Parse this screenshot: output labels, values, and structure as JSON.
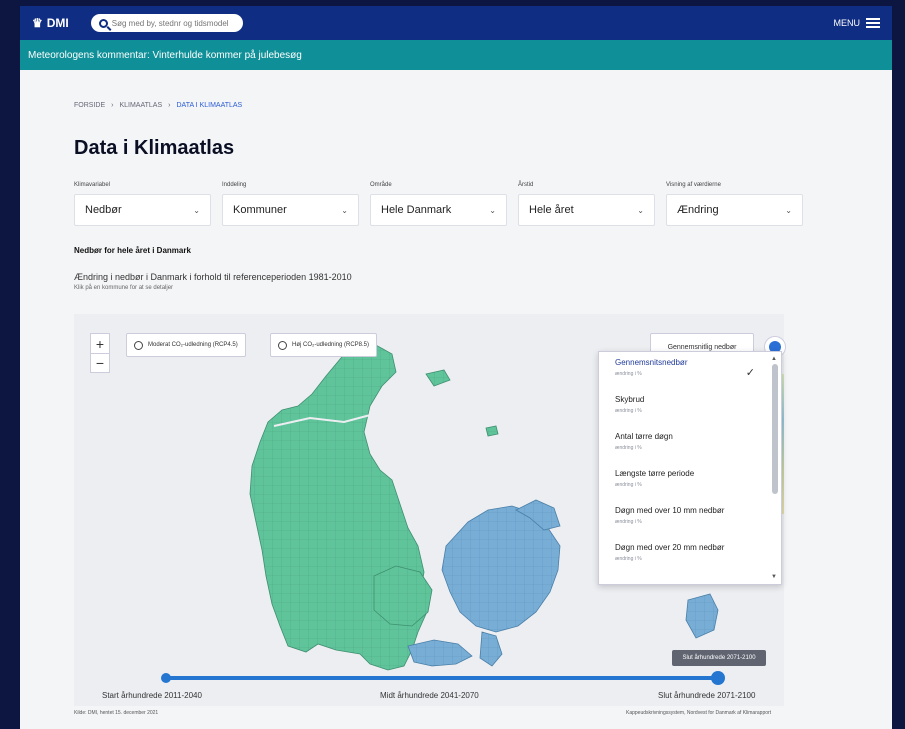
{
  "app": {
    "name": "DMI",
    "menu_label": "MENU"
  },
  "search": {
    "placeholder": "Søg med by, stednr og tidsmodel"
  },
  "banner": {
    "text": "Meteorologens kommentar: Vinterhulde kommer på julebesøg"
  },
  "breadcrumb": [
    "FORSIDE",
    "KLIMAATLAS",
    "DATA I KLIMAATLAS"
  ],
  "page": {
    "title": "Data i Klimaatlas"
  },
  "filters": [
    {
      "label": "Klimavariabel",
      "value": "Nedbør"
    },
    {
      "label": "Inddeling",
      "value": "Kommuner"
    },
    {
      "label": "Område",
      "value": "Hele Danmark"
    },
    {
      "label": "Årstid",
      "value": "Hele året"
    },
    {
      "label": "Visning af værdierne",
      "value": "Ændring"
    }
  ],
  "section": {
    "heading": "Nedbør for hele året i Danmark",
    "description": "Ændring i nedbør i Danmark i forhold til referenceperioden 1981-2010",
    "subdescription": "Klik på en kommune for at se detaljer"
  },
  "map": {
    "zoom_in": "+",
    "zoom_out": "−",
    "scenario_low": "Moderat CO₂-udledning (RCP4.5)",
    "scenario_high": "Høj CO₂-udledning (RCP8.5)",
    "measure_button": "Gennemsnitlig nedbør",
    "colors": {
      "west": "#5fc49a",
      "east": "#78aed6",
      "panel": "#eceef2"
    },
    "dropdown_items": [
      {
        "title": "Gennemsnitsnedbør",
        "sub": "ændring i %",
        "selected": true
      },
      {
        "title": "Skybrud",
        "sub": "ændring i %",
        "selected": false
      },
      {
        "title": "Antal tørre døgn",
        "sub": "ændring i %",
        "selected": false
      },
      {
        "title": "Længste tørre periode",
        "sub": "ændring i %",
        "selected": false
      },
      {
        "title": "Døgn med over 10 mm nedbør",
        "sub": "ændring i %",
        "selected": false
      },
      {
        "title": "Døgn med over 20 mm nedbør",
        "sub": "ændring i %",
        "selected": false
      }
    ],
    "check_icon": "✓",
    "slider_tooltip": "Slut århundrede 2071-2100",
    "slider_labels": {
      "start": "Start århundrede 2011-2040",
      "mid": "Midt århundrede 2041-2070",
      "end": "Slut århundrede 2071-2100"
    },
    "slider_value": 1.0
  },
  "footer": {
    "left": "Kilde: DMI, hentet 15. december 2021",
    "right": "Kappeudskrivningssystem, Nordvest for Danmark af Klimarapport"
  }
}
